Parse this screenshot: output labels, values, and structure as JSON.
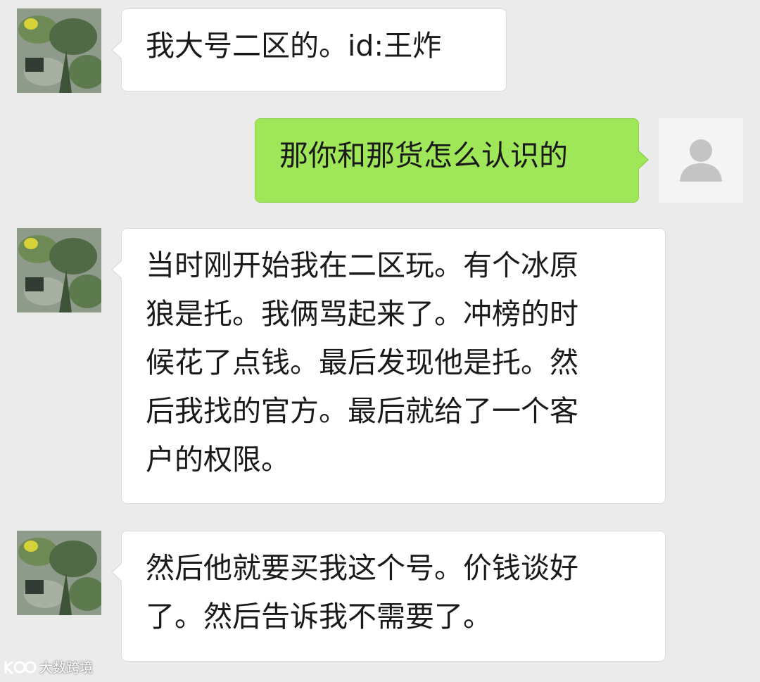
{
  "messages": [
    {
      "side": "left",
      "avatar": "plant-photo-avatar",
      "text": "我大号二区的。id:王炸"
    },
    {
      "side": "right",
      "avatar": "default-user-avatar",
      "text": "那你和那货怎么认识的"
    },
    {
      "side": "left",
      "avatar": "plant-photo-avatar",
      "lines": [
        "当时刚开始我在二区玩。有个冰原",
        "狼是托。我俩骂起来了。冲榜的时",
        "候花了点钱。最后发现他是托。然",
        "后我找的官方。最后就给了一个客",
        "户的权限。"
      ]
    },
    {
      "side": "left",
      "avatar": "plant-photo-avatar",
      "lines": [
        "然后他就要买我这个号。价钱谈好",
        "了。然后告诉我不需要了。"
      ]
    }
  ],
  "watermark": {
    "text": "大数跨境",
    "icon": "logo-icon"
  },
  "colors": {
    "background": "#ebebeb",
    "incoming_bubble": "#ffffff",
    "outgoing_bubble": "#9fe658"
  }
}
